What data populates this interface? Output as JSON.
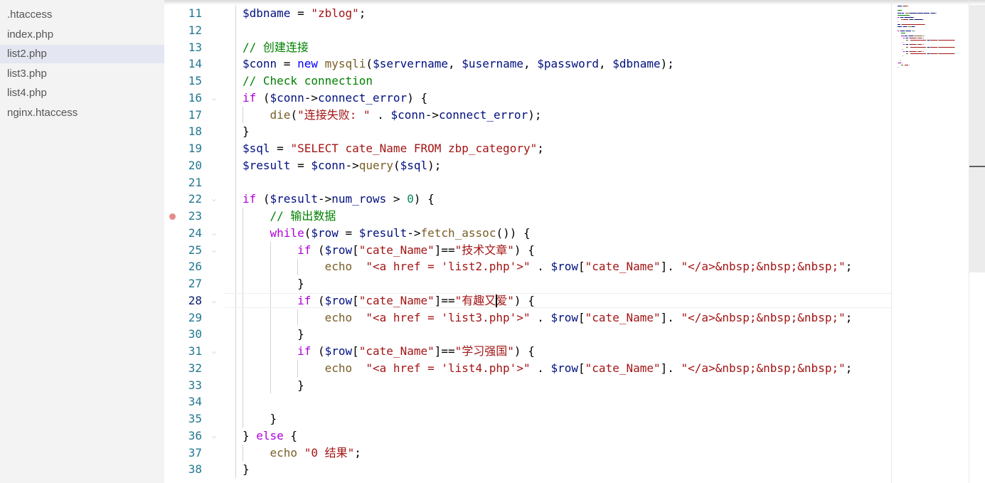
{
  "sidebar": {
    "files": [
      {
        "name": ".htaccess"
      },
      {
        "name": "index.php"
      },
      {
        "name": "list2.php",
        "selected": true
      },
      {
        "name": "list3.php"
      },
      {
        "name": "list4.php"
      },
      {
        "name": "nginx.htaccess"
      }
    ]
  },
  "editor": {
    "colors": {
      "line_number": "#237893",
      "active_line_number": "#0b216f",
      "variable": "#001080",
      "control_keyword": "#af00db",
      "keyword": "#0000ff",
      "string": "#a31515",
      "comment": "#008000",
      "function": "#795e26",
      "number": "#098658",
      "breakpoint": "#e78a8a"
    },
    "breakpoint_line": 23,
    "active_line": 28,
    "lines": [
      {
        "n": "11",
        "fold": false,
        "tokens": [
          [
            "v",
            "$dbname"
          ],
          [
            "p",
            " = "
          ],
          [
            "s",
            "\"zblog\""
          ],
          [
            "p",
            ";"
          ]
        ]
      },
      {
        "n": "12",
        "fold": false,
        "tokens": []
      },
      {
        "n": "13",
        "fold": false,
        "tokens": [
          [
            "c",
            "// 创建连接"
          ]
        ]
      },
      {
        "n": "14",
        "fold": false,
        "tokens": [
          [
            "v",
            "$conn"
          ],
          [
            "p",
            " = "
          ],
          [
            "b",
            "new"
          ],
          [
            "p",
            " "
          ],
          [
            "f",
            "mysqli"
          ],
          [
            "p",
            "("
          ],
          [
            "v",
            "$servername"
          ],
          [
            "p",
            ", "
          ],
          [
            "v",
            "$username"
          ],
          [
            "p",
            ", "
          ],
          [
            "v",
            "$password"
          ],
          [
            "p",
            ", "
          ],
          [
            "v",
            "$dbname"
          ],
          [
            "p",
            ");"
          ]
        ]
      },
      {
        "n": "15",
        "fold": false,
        "tokens": [
          [
            "c",
            "// Check connection"
          ]
        ]
      },
      {
        "n": "16",
        "fold": true,
        "tokens": [
          [
            "k",
            "if"
          ],
          [
            "p",
            " ("
          ],
          [
            "v",
            "$conn"
          ],
          [
            "p",
            "->"
          ],
          [
            "v",
            "connect_error"
          ],
          [
            "p",
            ") {"
          ]
        ]
      },
      {
        "n": "17",
        "fold": false,
        "tokens": [
          [
            "p",
            "    "
          ],
          [
            "f",
            "die"
          ],
          [
            "p",
            "("
          ],
          [
            "s",
            "\"连接失败: \""
          ],
          [
            "p",
            " . "
          ],
          [
            "v",
            "$conn"
          ],
          [
            "p",
            "->"
          ],
          [
            "v",
            "connect_error"
          ],
          [
            "p",
            ");"
          ]
        ]
      },
      {
        "n": "18",
        "fold": false,
        "tokens": [
          [
            "p",
            "}"
          ]
        ]
      },
      {
        "n": "19",
        "fold": false,
        "tokens": [
          [
            "v",
            "$sql"
          ],
          [
            "p",
            " = "
          ],
          [
            "s",
            "\"SELECT cate_Name FROM zbp_category\""
          ],
          [
            "p",
            ";"
          ]
        ]
      },
      {
        "n": "20",
        "fold": false,
        "tokens": [
          [
            "v",
            "$result"
          ],
          [
            "p",
            " = "
          ],
          [
            "v",
            "$conn"
          ],
          [
            "p",
            "->"
          ],
          [
            "f",
            "query"
          ],
          [
            "p",
            "("
          ],
          [
            "v",
            "$sql"
          ],
          [
            "p",
            ");"
          ]
        ]
      },
      {
        "n": "21",
        "fold": false,
        "tokens": []
      },
      {
        "n": "22",
        "fold": true,
        "tokens": [
          [
            "k",
            "if"
          ],
          [
            "p",
            " ("
          ],
          [
            "v",
            "$result"
          ],
          [
            "p",
            "->"
          ],
          [
            "v",
            "num_rows"
          ],
          [
            "p",
            " > "
          ],
          [
            "n",
            "0"
          ],
          [
            "p",
            ") {"
          ]
        ]
      },
      {
        "n": "23",
        "fold": false,
        "tokens": [
          [
            "p",
            "    "
          ],
          [
            "c",
            "// 输出数据"
          ]
        ]
      },
      {
        "n": "24",
        "fold": true,
        "tokens": [
          [
            "p",
            "    "
          ],
          [
            "k",
            "while"
          ],
          [
            "p",
            "("
          ],
          [
            "v",
            "$row"
          ],
          [
            "p",
            " = "
          ],
          [
            "v",
            "$result"
          ],
          [
            "p",
            "->"
          ],
          [
            "f",
            "fetch_assoc"
          ],
          [
            "p",
            "()) {"
          ]
        ]
      },
      {
        "n": "25",
        "fold": true,
        "tokens": [
          [
            "p",
            "        "
          ],
          [
            "k",
            "if"
          ],
          [
            "p",
            " ("
          ],
          [
            "v",
            "$row"
          ],
          [
            "p",
            "["
          ],
          [
            "s",
            "\"cate_Name\""
          ],
          [
            "p",
            "]=="
          ],
          [
            "s",
            "\"技术文章\""
          ],
          [
            "p",
            ") {"
          ]
        ]
      },
      {
        "n": "26",
        "fold": false,
        "tokens": [
          [
            "p",
            "            "
          ],
          [
            "f",
            "echo"
          ],
          [
            "p",
            "  "
          ],
          [
            "s",
            "\"<a href = 'list2.php'>\""
          ],
          [
            "p",
            " . "
          ],
          [
            "v",
            "$row"
          ],
          [
            "p",
            "["
          ],
          [
            "s",
            "\"cate_Name\""
          ],
          [
            "p",
            "]. "
          ],
          [
            "s",
            "\"</a>&nbsp;&nbsp;&nbsp;\""
          ],
          [
            "p",
            ";"
          ]
        ]
      },
      {
        "n": "27",
        "fold": false,
        "tokens": [
          [
            "p",
            "        }"
          ]
        ]
      },
      {
        "n": "28",
        "fold": true,
        "tokens": [
          [
            "p",
            "        "
          ],
          [
            "k",
            "if"
          ],
          [
            "p",
            " ("
          ],
          [
            "v",
            "$row"
          ],
          [
            "p",
            "["
          ],
          [
            "s",
            "\"cate_Name\""
          ],
          [
            "p",
            "]=="
          ],
          [
            "s",
            "\"有趣又爱\""
          ],
          [
            "p",
            ") {"
          ]
        ]
      },
      {
        "n": "29",
        "fold": false,
        "tokens": [
          [
            "p",
            "            "
          ],
          [
            "f",
            "echo"
          ],
          [
            "p",
            "  "
          ],
          [
            "s",
            "\"<a href = 'list3.php'>\""
          ],
          [
            "p",
            " . "
          ],
          [
            "v",
            "$row"
          ],
          [
            "p",
            "["
          ],
          [
            "s",
            "\"cate_Name\""
          ],
          [
            "p",
            "]. "
          ],
          [
            "s",
            "\"</a>&nbsp;&nbsp;&nbsp;\""
          ],
          [
            "p",
            ";"
          ]
        ]
      },
      {
        "n": "30",
        "fold": false,
        "tokens": [
          [
            "p",
            "        }"
          ]
        ]
      },
      {
        "n": "31",
        "fold": true,
        "tokens": [
          [
            "p",
            "        "
          ],
          [
            "k",
            "if"
          ],
          [
            "p",
            " ("
          ],
          [
            "v",
            "$row"
          ],
          [
            "p",
            "["
          ],
          [
            "s",
            "\"cate_Name\""
          ],
          [
            "p",
            "]=="
          ],
          [
            "s",
            "\"学习强国\""
          ],
          [
            "p",
            ") {"
          ]
        ]
      },
      {
        "n": "32",
        "fold": false,
        "tokens": [
          [
            "p",
            "            "
          ],
          [
            "f",
            "echo"
          ],
          [
            "p",
            "  "
          ],
          [
            "s",
            "\"<a href = 'list4.php'>\""
          ],
          [
            "p",
            " . "
          ],
          [
            "v",
            "$row"
          ],
          [
            "p",
            "["
          ],
          [
            "s",
            "\"cate_Name\""
          ],
          [
            "p",
            "]. "
          ],
          [
            "s",
            "\"</a>&nbsp;&nbsp;&nbsp;\""
          ],
          [
            "p",
            ";"
          ]
        ]
      },
      {
        "n": "33",
        "fold": false,
        "tokens": [
          [
            "p",
            "        }"
          ]
        ]
      },
      {
        "n": "34",
        "fold": false,
        "tokens": []
      },
      {
        "n": "35",
        "fold": false,
        "tokens": [
          [
            "p",
            "    }"
          ]
        ]
      },
      {
        "n": "36",
        "fold": true,
        "tokens": [
          [
            "p",
            "} "
          ],
          [
            "k",
            "else"
          ],
          [
            "p",
            " {"
          ]
        ]
      },
      {
        "n": "37",
        "fold": false,
        "tokens": [
          [
            "p",
            "    "
          ],
          [
            "f",
            "echo"
          ],
          [
            "p",
            " "
          ],
          [
            "s",
            "\"0 结果\""
          ],
          [
            "p",
            ";"
          ]
        ]
      },
      {
        "n": "38",
        "fold": false,
        "tokens": [
          [
            "p",
            "}"
          ]
        ]
      }
    ]
  }
}
